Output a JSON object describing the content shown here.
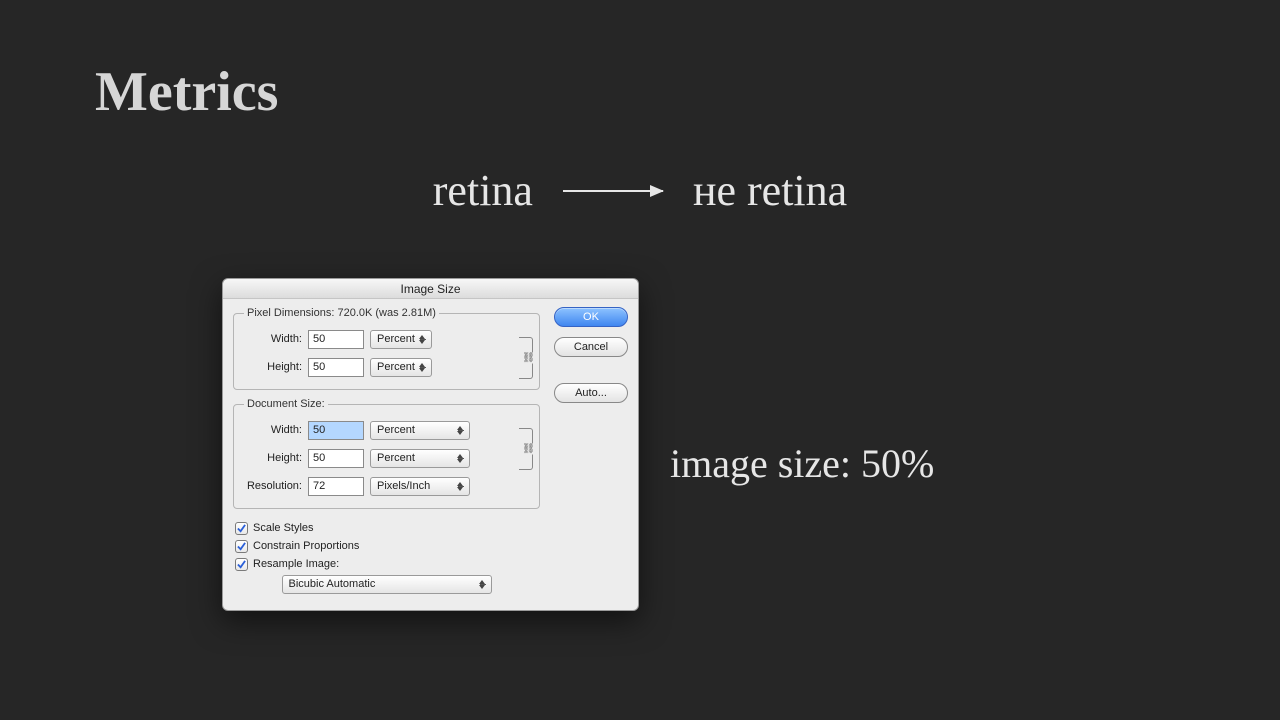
{
  "slide": {
    "title": "Metrics",
    "arrow_left": "retina",
    "arrow_right": "не retina",
    "caption": "image size: 50%"
  },
  "dialog": {
    "title": "Image Size",
    "buttons": {
      "ok": "OK",
      "cancel": "Cancel",
      "auto": "Auto..."
    },
    "pixel_dimensions": {
      "legend": "Pixel Dimensions:  720.0K (was 2.81M)",
      "width_label": "Width:",
      "width_value": "50",
      "width_unit": "Percent",
      "height_label": "Height:",
      "height_value": "50",
      "height_unit": "Percent"
    },
    "document_size": {
      "legend": "Document Size:",
      "width_label": "Width:",
      "width_value": "50",
      "width_unit": "Percent",
      "height_label": "Height:",
      "height_value": "50",
      "height_unit": "Percent",
      "res_label": "Resolution:",
      "res_value": "72",
      "res_unit": "Pixels/Inch"
    },
    "checks": {
      "scale_styles": "Scale Styles",
      "constrain": "Constrain Proportions",
      "resample": "Resample Image:"
    },
    "resample_method": "Bicubic Automatic"
  }
}
